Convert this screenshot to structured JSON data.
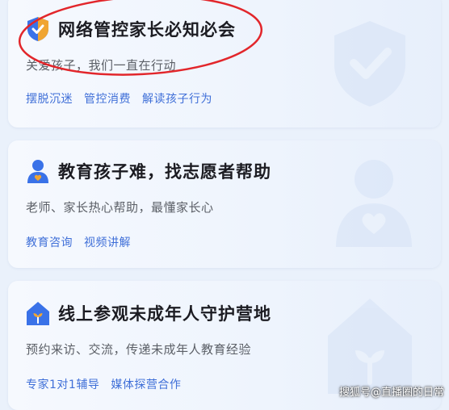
{
  "cards": [
    {
      "title": "网络管控家长必知必会",
      "subtitle": "关爱孩子，我们一直在行动",
      "tags": [
        "摆脱沉迷",
        "管控消费",
        "解读孩子行为"
      ],
      "icon": "shield-check-icon"
    },
    {
      "title": "教育孩子难，找志愿者帮助",
      "subtitle": "老师、家长热心帮助，最懂家长心",
      "tags": [
        "教育咨询",
        "视频讲解"
      ],
      "icon": "person-heart-icon"
    },
    {
      "title": "线上参观未成年人守护营地",
      "subtitle": "预约来访、交流，传递未成年人教育经验",
      "tags": [
        "专家1对1辅导",
        "媒体探营合作"
      ],
      "icon": "house-sprout-icon"
    }
  ],
  "watermark_credit": "搜狐号@直播圈的日常",
  "colors": {
    "accent": "#3f6fd8",
    "icon_blue": "#3a72e8",
    "annotation_red": "#e2262b"
  }
}
